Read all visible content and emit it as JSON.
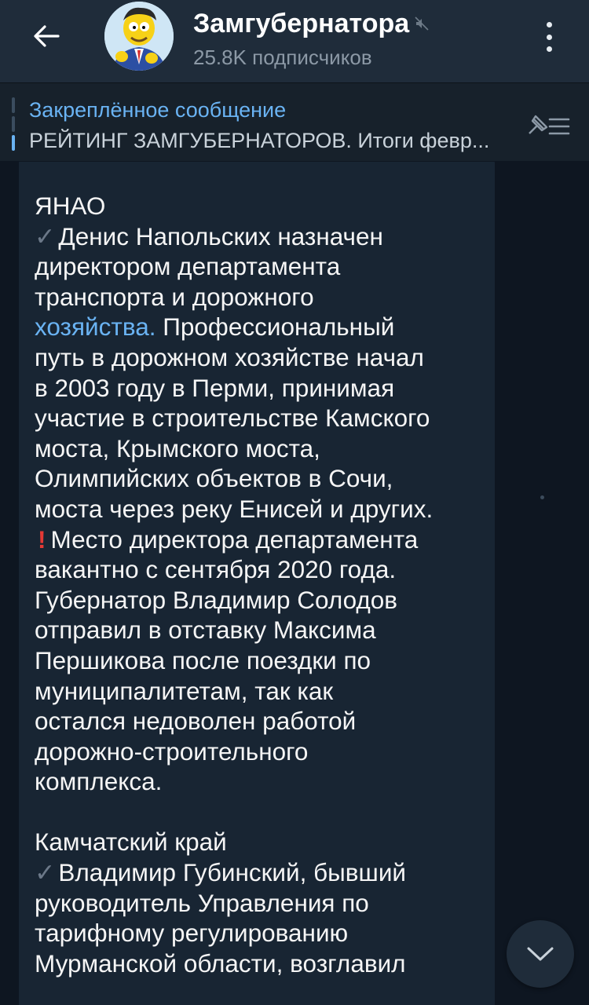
{
  "header": {
    "title": "Замгубернатора",
    "subscribers": "25.8K подписчиков"
  },
  "pinned": {
    "label": "Закреплённое сообщение",
    "text": "РЕЙТИНГ ЗАМГУБЕРНАТОРОВ. Итоги февр..."
  },
  "message": {
    "region1": "ЯНАО",
    "p1_l1": "Денис Напольских назначен",
    "p1_l2": "директором департамента",
    "p1_l3": "транспорта и дорожного",
    "p1_link": "хозяйства.",
    "p1_l4": " Профессиональный",
    "p1_l5": "путь в дорожном хозяйстве начал",
    "p1_l6": "в 2003 году в Перми, принимая",
    "p1_l7": "участие в строительстве Камского",
    "p1_l8": "моста, Крымского моста,",
    "p1_l9": "Олимпийских объектов в Сочи,",
    "p1_l10": "моста через реку Енисей и других.",
    "p2_l1": "Место директора департамента",
    "p2_l2": "вакантно с сентября 2020 года.",
    "p2_l3": "Губернатор Владимир Солодов",
    "p2_l4": "отправил в отставку Максима",
    "p2_l5": "Першикова после поездки по",
    "p2_l6": "муниципалитетам, так как",
    "p2_l7": "остался недоволен работой",
    "p2_l8": "дорожно-строительного",
    "p2_l9": "комплекса.",
    "region2": "Камчатский край",
    "p3_l1": "Владимир Губинский, бывший",
    "p3_l2": "руководитель Управления по",
    "p3_l3": "тарифному регулированию",
    "p3_l4": "Мурманской области, возглавил"
  },
  "icons": {
    "check": "✓",
    "exclaim": "!"
  },
  "colors": {
    "header_bg": "#1f2c3a",
    "chat_bg": "#0e1621",
    "bubble_bg": "#182533",
    "accent": "#6ab3f3",
    "alert": "#e53935"
  }
}
